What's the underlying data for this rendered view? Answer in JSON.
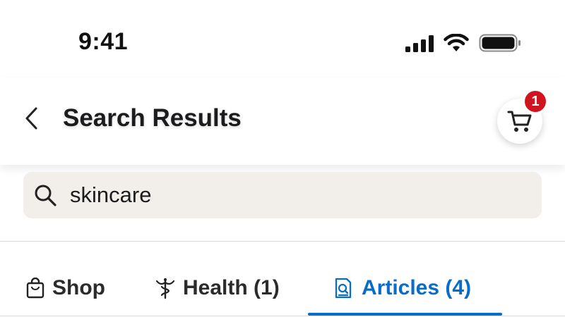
{
  "status_bar": {
    "time": "9:41"
  },
  "header": {
    "title": "Search Results",
    "cart_count": "1"
  },
  "search": {
    "value": "skincare",
    "placeholder": ""
  },
  "tabs": [
    {
      "label": "Shop",
      "icon": "shopping-bag-icon",
      "active": false
    },
    {
      "label": "Health (1)",
      "icon": "caduceus-icon",
      "active": false
    },
    {
      "label": "Articles (4)",
      "icon": "article-search-icon",
      "active": true
    }
  ],
  "colors": {
    "accent": "#0a6cc9",
    "badge": "#d0141f",
    "search_bg": "#f2efea"
  }
}
